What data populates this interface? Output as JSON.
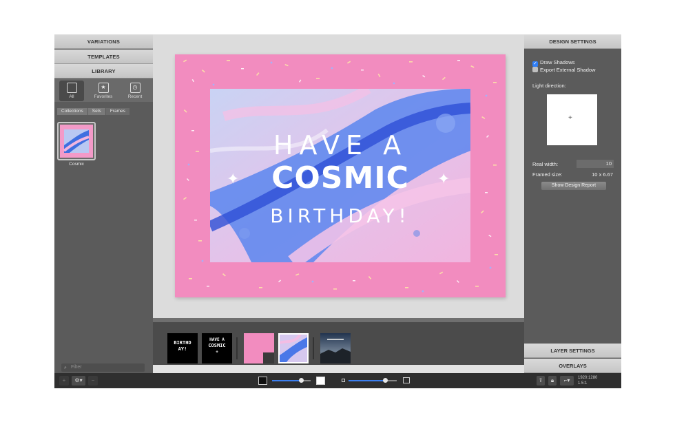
{
  "left_panel": {
    "headers": [
      "VARIATIONS",
      "TEMPLATES",
      "LIBRARY"
    ],
    "library_filters": [
      {
        "label": "All",
        "icon": "square-icon"
      },
      {
        "label": "Favorites",
        "icon": "star-icon"
      },
      {
        "label": "Recent",
        "icon": "clock-icon"
      }
    ],
    "breadcrumbs": [
      "Collections",
      "Sets",
      "Frames"
    ],
    "items": [
      {
        "label": "Cosmic"
      }
    ],
    "filter_placeholder": "Filter"
  },
  "card": {
    "line1": "HAVE A",
    "line2": "COSMIC",
    "line3": "BIRTHDAY!",
    "frame_color": "#f28cbf"
  },
  "thumbnail_strip": {
    "thumb1_text": "BIRTHD AY!",
    "thumb2_line1": "HAVE A",
    "thumb2_line2": "COSMIC"
  },
  "right_panel": {
    "design_settings": "DESIGN SETTINGS",
    "draw_shadows": {
      "label": "Draw Shadows",
      "checked": true
    },
    "export_shadow": {
      "label": "Export External Shadow",
      "checked": false
    },
    "light_direction_label": "Light direction:",
    "real_width_label": "Real width:",
    "real_width_value": "10",
    "framed_size_label": "Framed size:",
    "framed_size_value": "10 x 6.67",
    "report_button": "Show Design Report",
    "layer_settings": "LAYER SETTINGS",
    "overlays": "OVERLAYS"
  },
  "bottom_bar": {
    "add_label": "+",
    "gear_label": "⚙▾",
    "remove_label": "−",
    "resolution": "1920:1280",
    "ratio": "1.5:1",
    "zoom_fraction": 0.75,
    "size_fraction": 0.75
  },
  "colors": {
    "accent": "#2f7ef6",
    "pink": "#f28cbf"
  }
}
